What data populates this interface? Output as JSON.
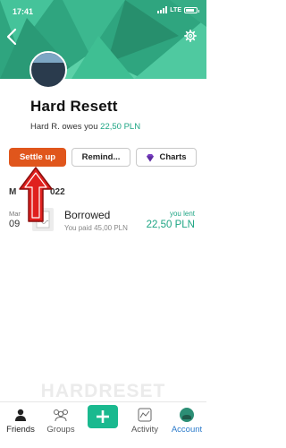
{
  "status_bar": {
    "time": "17:41",
    "network": "LTE",
    "battery_level": 0.85
  },
  "header": {
    "back_icon": "chevron-left-icon",
    "settings_icon": "gear-icon"
  },
  "profile": {
    "name": "Hard Resett",
    "balance_prefix": "Hard R. owes you",
    "balance_amount": "22,50 PLN"
  },
  "actions": {
    "settle_up": "Settle up",
    "remind": "Remind...",
    "charts": "Charts"
  },
  "expenses": {
    "month_label": "M",
    "year_label": "022",
    "items": [
      {
        "month_short": "Mar",
        "day": "09",
        "title": "Borrowed",
        "subtitle": "You paid 45,00 PLN",
        "status_label": "you lent",
        "amount": "22,50 PLN"
      }
    ]
  },
  "watermark": "HARDRESET",
  "tabbar": {
    "friends": "Friends",
    "groups": "Groups",
    "activity": "Activity",
    "account": "Account"
  },
  "colors": {
    "brand_green": "#3bb38d",
    "positive_amount": "#1ea584",
    "settle_button": "#e0561c",
    "arrow_red": "#e0201e",
    "active_tab": "#2c7bcb"
  }
}
